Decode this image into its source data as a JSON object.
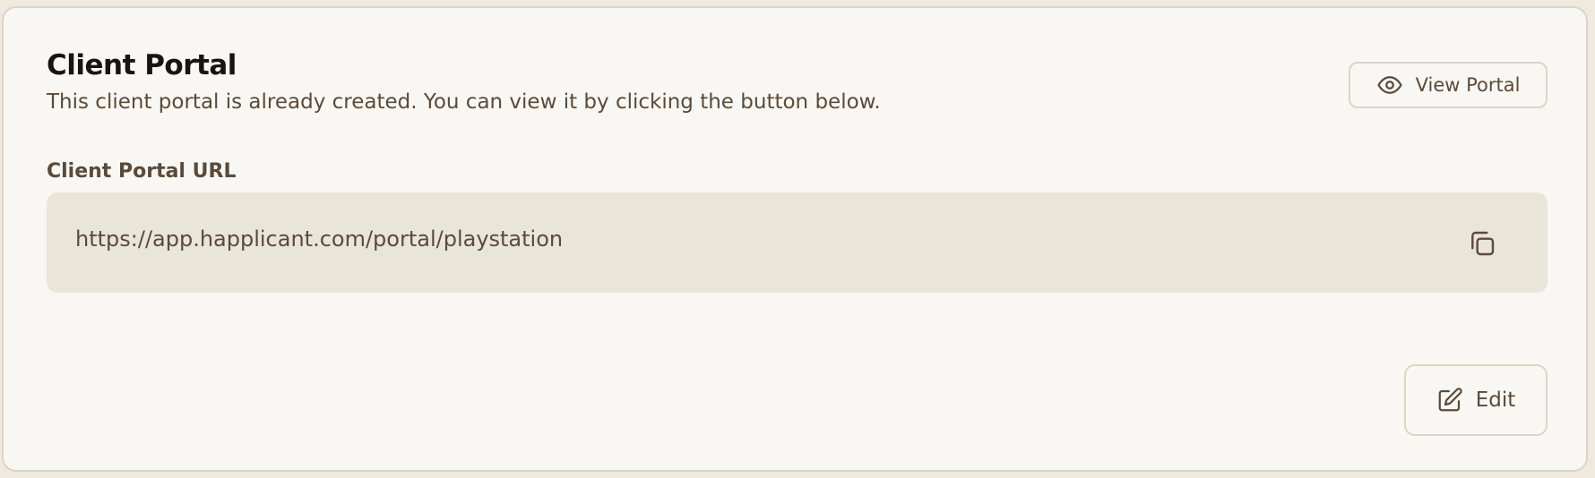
{
  "portal": {
    "title": "Client Portal",
    "subtitle": "This client portal is already created. You can view it by clicking the button below.",
    "view_button_label": "View Portal",
    "url_label": "Client Portal URL",
    "url_value": "https://app.happlicant.com/portal/playstation",
    "edit_button_label": "Edit"
  },
  "icons": {
    "view": "eye-icon",
    "copy": "copy-icon",
    "edit": "edit-icon"
  },
  "colors": {
    "page_background": "#efe9de",
    "card_background": "#f8f7f3",
    "border": "#ddd4c6",
    "url_field_background": "#eae5d9",
    "title_text": "#191410",
    "body_text": "#5b4a3a"
  }
}
